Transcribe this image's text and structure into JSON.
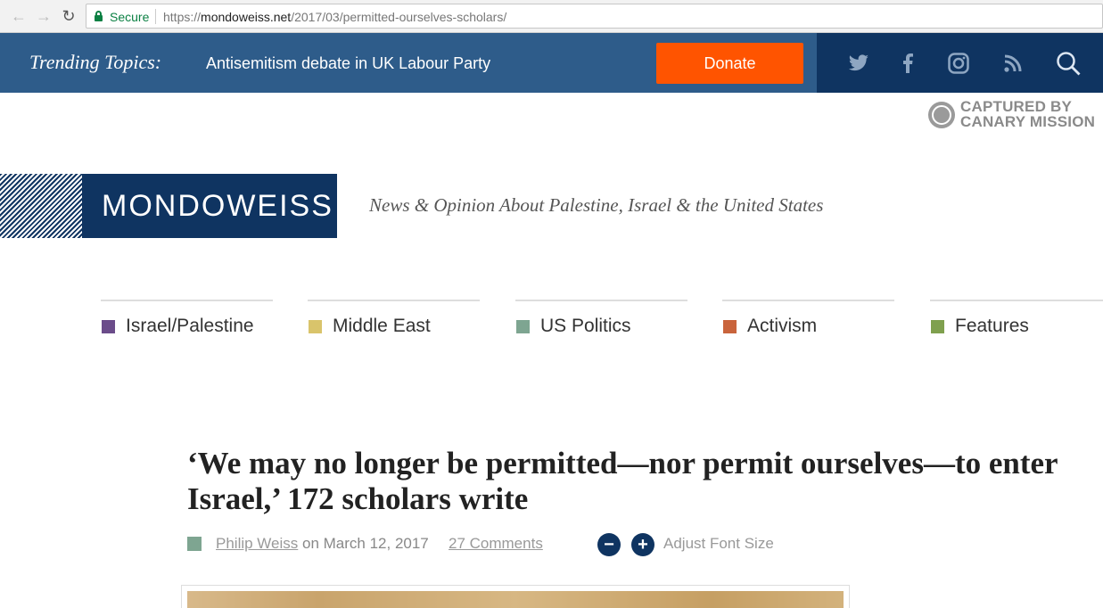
{
  "browser": {
    "secure_label": "Secure",
    "url_prefix": "https://",
    "url_host": "mondoweiss.net",
    "url_path": "/2017/03/permitted-ourselves-scholars/",
    "back_icon": "back-arrow-icon",
    "forward_icon": "forward-arrow-icon",
    "reload_icon": "reload-icon"
  },
  "topbar": {
    "trending_label": "Trending Topics:",
    "trending_link": "Antisemitism debate in UK Labour Party",
    "donate_label": "Donate",
    "colors": {
      "bar": "#2e5c8a",
      "dark": "#0f3461",
      "donate": "#ff5400"
    },
    "social_icons": [
      "twitter-icon",
      "facebook-icon",
      "instagram-icon",
      "rss-icon",
      "search-icon"
    ]
  },
  "canary": {
    "line1": "CAPTURED BY",
    "line2": "CANARY MISSION"
  },
  "header": {
    "logo": "MONDOWEISS",
    "tagline": "News & Opinion About Palestine, Israel & the United States"
  },
  "categories": [
    {
      "label": "Israel/Palestine",
      "color": "#6b4c8a"
    },
    {
      "label": "Middle East",
      "color": "#d9c46b"
    },
    {
      "label": "US Politics",
      "color": "#7ea591"
    },
    {
      "label": "Activism",
      "color": "#c9643c"
    },
    {
      "label": "Features",
      "color": "#7fa04e"
    }
  ],
  "article": {
    "headline": "‘We may no longer be permitted—nor permit ourselves—to enter Israel,’ 172 scholars write",
    "author": "Philip Weiss",
    "on_date": " on March 12, 2017",
    "comments": "27 Comments",
    "font_decrease": "−",
    "font_increase": "+",
    "adjust_label": "Adjust Font Size"
  }
}
